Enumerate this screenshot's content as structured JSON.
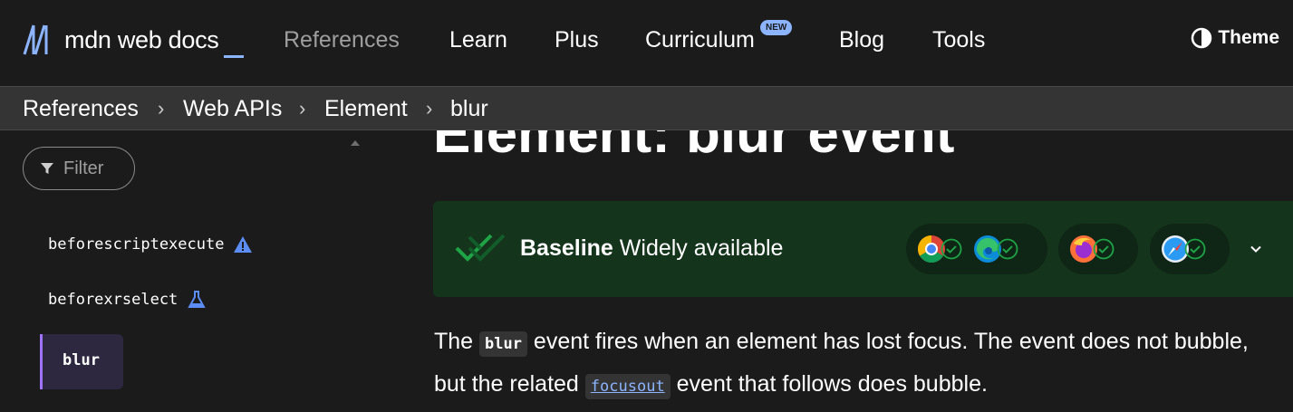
{
  "nav": {
    "logo_text": "mdn web docs",
    "items": [
      {
        "label": "References"
      },
      {
        "label": "Learn"
      },
      {
        "label": "Plus"
      },
      {
        "label": "Curriculum"
      },
      {
        "label": "Blog"
      },
      {
        "label": "Tools"
      }
    ],
    "new_badge": "NEW",
    "theme_label": "Theme"
  },
  "breadcrumb": [
    "References",
    "Web APIs",
    "Element",
    "blur"
  ],
  "sidebar": {
    "filter_placeholder": "Filter",
    "items": [
      {
        "label": "beforescriptexecute",
        "icon": "warning-icon"
      },
      {
        "label": "beforexrselect",
        "icon": "flask-icon"
      },
      {
        "label": "blur",
        "active": true
      }
    ]
  },
  "main": {
    "title": "Element: blur event",
    "baseline": {
      "strong": "Baseline",
      "rest": " Widely available",
      "browsers": [
        "chrome",
        "edge",
        "firefox",
        "safari"
      ]
    },
    "paragraph": {
      "p1": "The ",
      "code1": "blur",
      "p2": " event fires when an element has lost focus. The event does not bubble, but the related ",
      "link": "focusout",
      "p3": " event that follows does bubble."
    }
  },
  "colors": {
    "accent": "#8cb4ff",
    "baseline_bg": "#15341c",
    "check": "#1ea446",
    "active_border": "#9e74ff"
  }
}
